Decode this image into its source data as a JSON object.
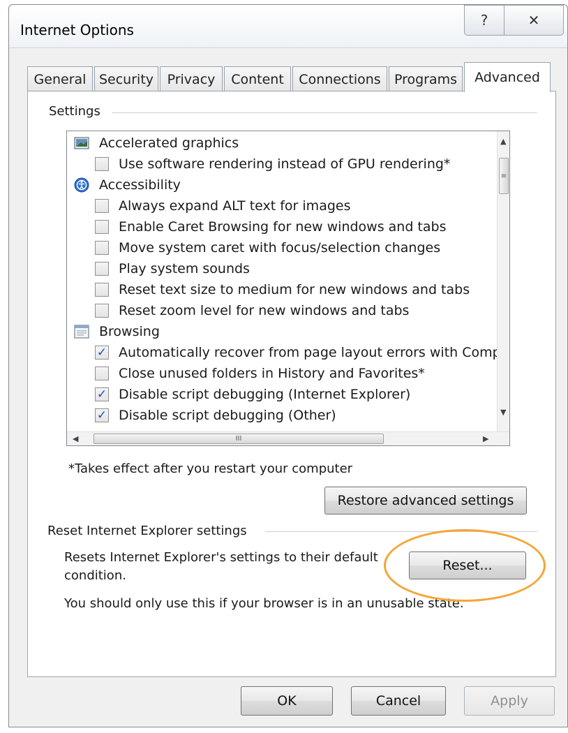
{
  "window": {
    "title": "Internet Options",
    "help_glyph": "?",
    "close_glyph": "✕"
  },
  "tabs": [
    {
      "label": "General"
    },
    {
      "label": "Security"
    },
    {
      "label": "Privacy"
    },
    {
      "label": "Content"
    },
    {
      "label": "Connections"
    },
    {
      "label": "Programs"
    },
    {
      "label": "Advanced",
      "active": true
    }
  ],
  "settings": {
    "group_label": "Settings",
    "items": [
      {
        "type": "category",
        "icon": "monitor-icon",
        "label": "Accelerated graphics"
      },
      {
        "type": "checkbox",
        "checked": false,
        "label": "Use software rendering instead of GPU rendering*"
      },
      {
        "type": "category",
        "icon": "accessibility-icon",
        "label": "Accessibility"
      },
      {
        "type": "checkbox",
        "checked": false,
        "label": "Always expand ALT text for images"
      },
      {
        "type": "checkbox",
        "checked": false,
        "label": "Enable Caret Browsing for new windows and tabs"
      },
      {
        "type": "checkbox",
        "checked": false,
        "label": "Move system caret with focus/selection changes"
      },
      {
        "type": "checkbox",
        "checked": false,
        "label": "Play system sounds"
      },
      {
        "type": "checkbox",
        "checked": false,
        "label": "Reset text size to medium for new windows and tabs"
      },
      {
        "type": "checkbox",
        "checked": false,
        "label": "Reset zoom level for new windows and tabs"
      },
      {
        "type": "category",
        "icon": "browsing-icon",
        "label": "Browsing"
      },
      {
        "type": "checkbox",
        "checked": true,
        "label": "Automatically recover from page layout errors with Compa"
      },
      {
        "type": "checkbox",
        "checked": false,
        "label": "Close unused folders in History and Favorites*"
      },
      {
        "type": "checkbox",
        "checked": true,
        "label": "Disable script debugging (Internet Explorer)"
      },
      {
        "type": "checkbox",
        "checked": true,
        "label": "Disable script debugging (Other)"
      }
    ],
    "scroll_thumb_glyph": "≡",
    "hscroll_thumb_glyph": "III",
    "note": "*Takes effect after you restart your computer",
    "restore_label": "Restore advanced settings"
  },
  "reset_section": {
    "group_label": "Reset Internet Explorer settings",
    "description_line1": "Resets Internet Explorer's settings to their default",
    "description_line2": "condition.",
    "reset_label": "Reset...",
    "warning": "You should only use this if your browser is in an unusable state."
  },
  "footer": {
    "ok_label": "OK",
    "cancel_label": "Cancel",
    "apply_label": "Apply"
  },
  "colors": {
    "highlight": "#f4a535",
    "check": "#1b4fbf"
  }
}
